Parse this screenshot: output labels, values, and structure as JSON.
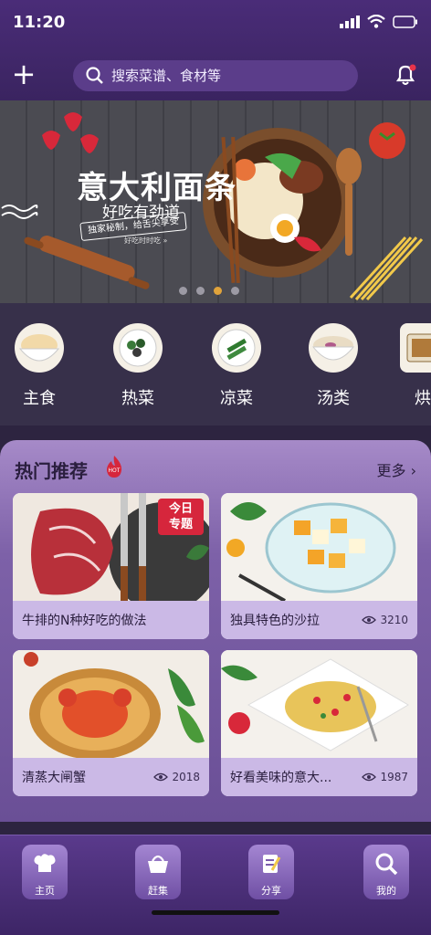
{
  "status": {
    "time": "11:20"
  },
  "header": {
    "search_placeholder": "搜索菜谱、食材等"
  },
  "banner": {
    "title": "意大利面条",
    "subtitle": "好吃有劲道",
    "tag": "独家秘制，给舌尖享受",
    "note": "好吃时时吃 »",
    "page_count": 4,
    "active_page": 3
  },
  "categories": [
    {
      "label": "主食",
      "icon": "rice-bowl-icon"
    },
    {
      "label": "热菜",
      "icon": "hot-dish-icon"
    },
    {
      "label": "凉菜",
      "icon": "cold-dish-icon"
    },
    {
      "label": "汤类",
      "icon": "soup-bowl-icon"
    },
    {
      "label": "烘",
      "icon": "oven-icon"
    }
  ],
  "hot": {
    "title": "热门推荐",
    "badge": "HOT",
    "more": "更多",
    "cards": [
      {
        "title": "牛排的N种好吃的做法",
        "views": "",
        "ribbon_line1": "今日",
        "ribbon_line2": "专题"
      },
      {
        "title": "独具特色的沙拉",
        "views": "3210"
      },
      {
        "title": "清蒸大闸蟹",
        "views": "2018"
      },
      {
        "title": "好看美味的意大...",
        "views": "1987"
      }
    ]
  },
  "tabs": [
    {
      "label": "主页"
    },
    {
      "label": "赶集"
    },
    {
      "label": "分享"
    },
    {
      "label": "我的"
    }
  ],
  "colors": {
    "accent": "#6a4f96",
    "hot_red": "#d6263c",
    "active_dot": "#e0a33b"
  }
}
